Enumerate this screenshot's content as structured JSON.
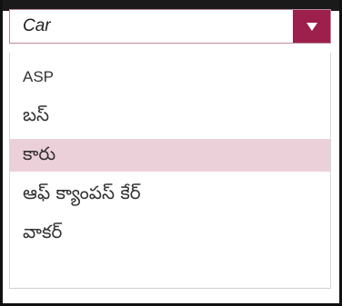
{
  "dropdown": {
    "selected_value": "Car",
    "toggle_icon": "triangle-down-icon",
    "accent_color": "#9c1f4c",
    "highlight_color": "#ecd0d9",
    "options": [
      {
        "label": "ASP"
      },
      {
        "label": "బస్"
      },
      {
        "label": "కారు"
      },
      {
        "label": "ఆఫ్ క్యాంపస్ కేర్"
      },
      {
        "label": "వాకర్"
      }
    ],
    "highlighted_option": "కారు"
  }
}
